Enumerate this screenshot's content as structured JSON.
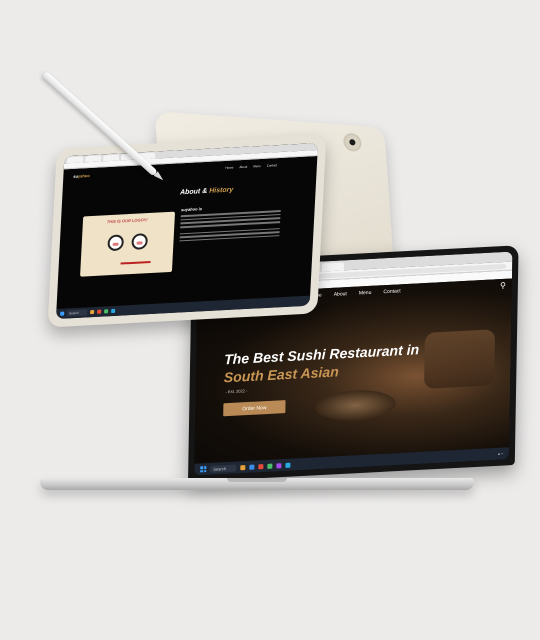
{
  "laptop": {
    "bookmarks": [
      "Gmail",
      "YouTube",
      "Maps",
      "Resume Samples",
      "SOFTWARE ENGINE..."
    ],
    "nav": [
      "Home",
      "About",
      "Menu",
      "Contact"
    ],
    "hero": {
      "title": "The Best Sushi Restaurant in",
      "subtitle": "South East Asian",
      "date": "- Est. 2022 -",
      "order_button": "Order Now"
    },
    "taskbar": {
      "search_label": "Search"
    }
  },
  "tablet": {
    "logo_main": "su",
    "logo_accent": "yahoo",
    "nav": [
      "Home",
      "About",
      "Menu",
      "Contact"
    ],
    "heading_main": "About &",
    "heading_accent": "History",
    "card_title": "THIS IS OUR LOGO!!!",
    "body_title": "suyahoo is",
    "taskbar": {
      "search_label": "Search"
    }
  },
  "colors": {
    "accent_gold": "#c99654",
    "button_bg": "#b98a55",
    "taskbar": "#1f2633"
  }
}
